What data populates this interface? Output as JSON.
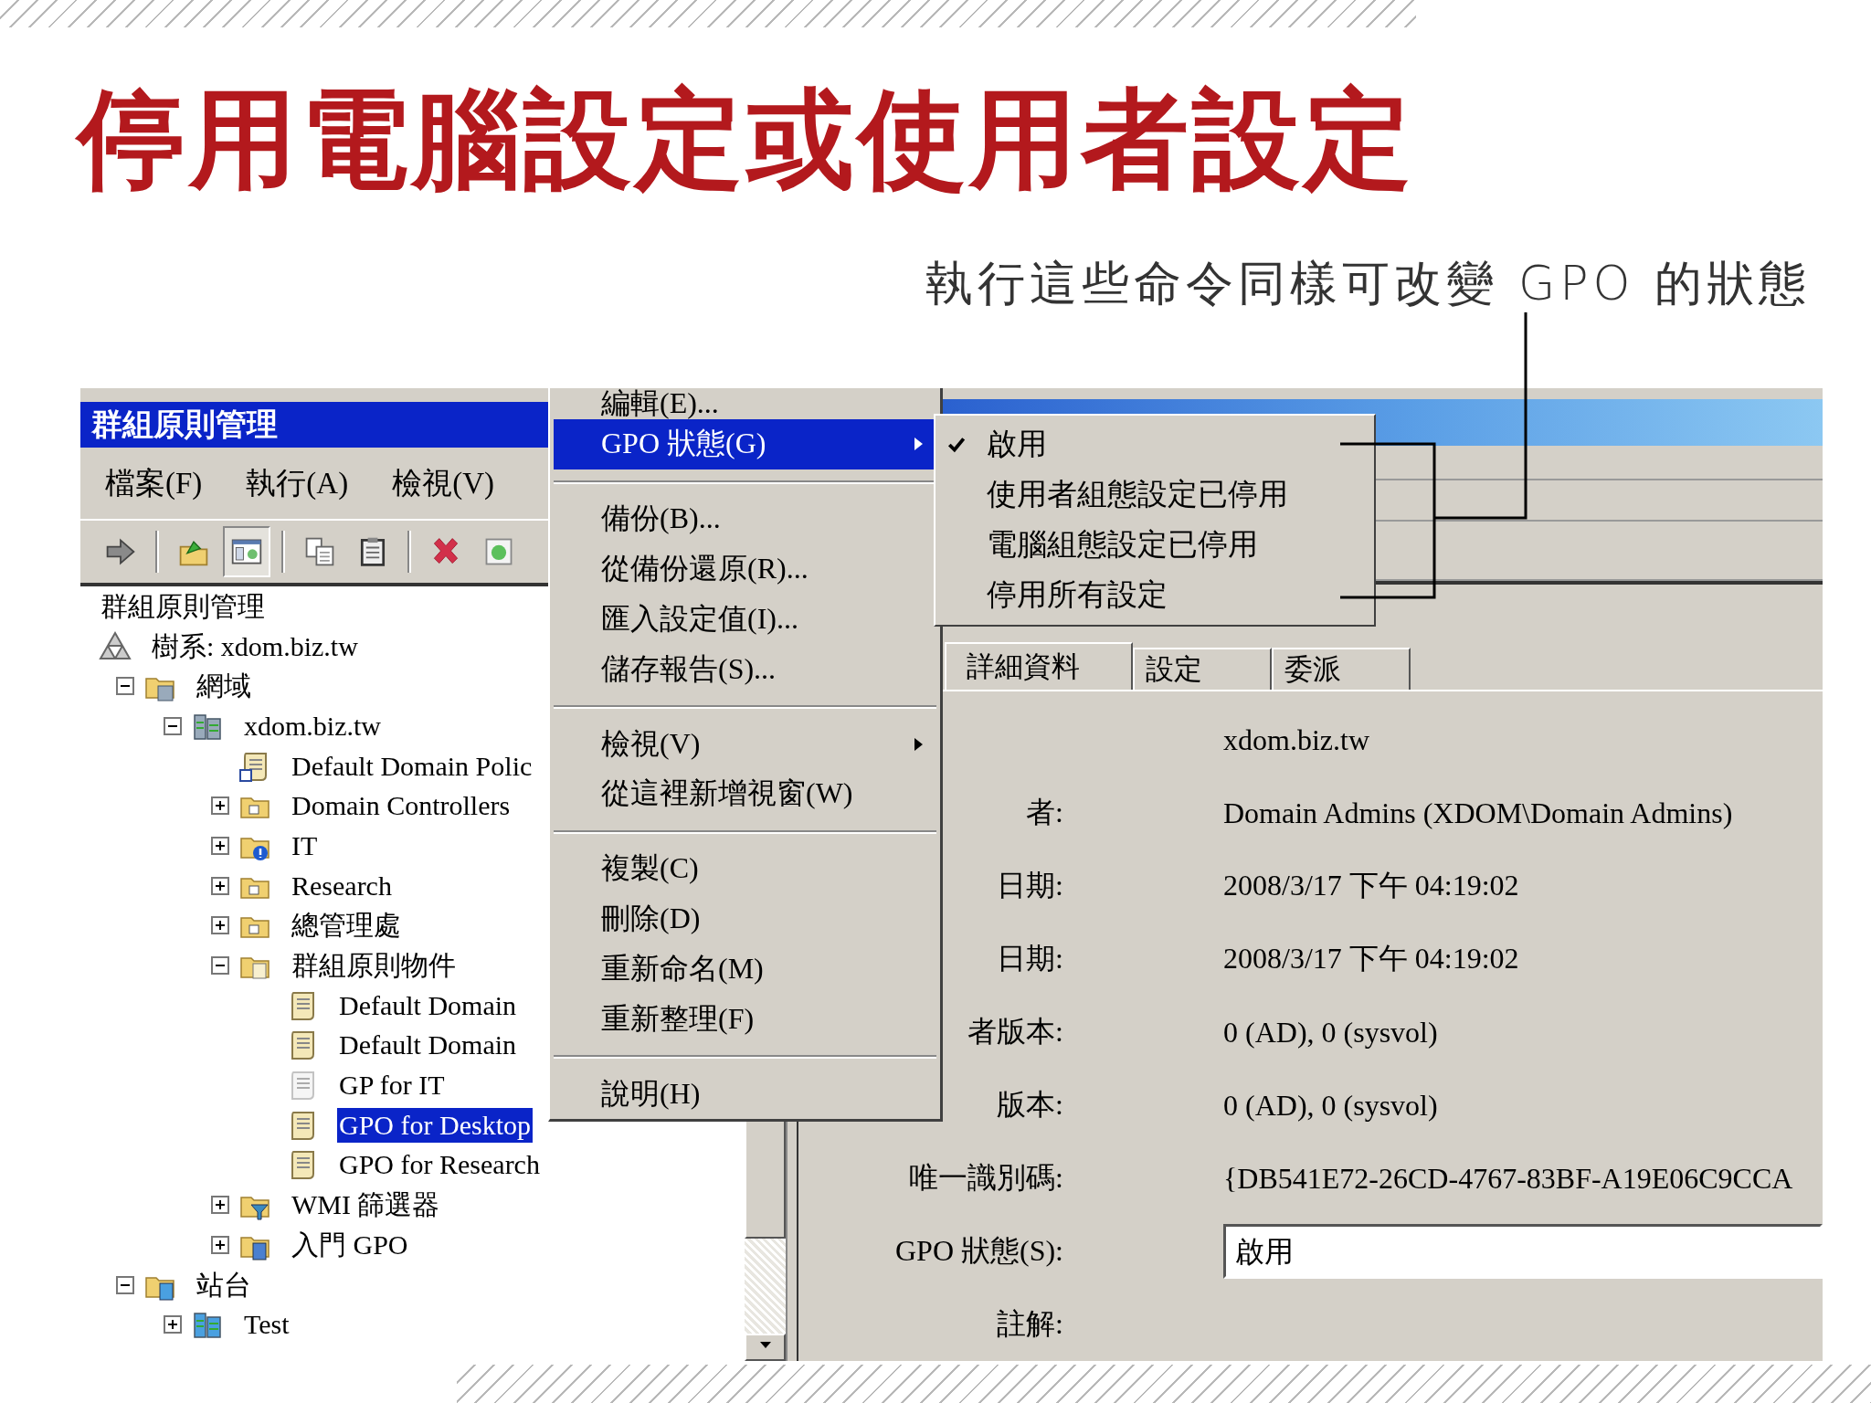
{
  "slide": {
    "title": "停用電腦設定或使用者設定",
    "callout": "執行這些命令同樣可改變 GPO 的狀態"
  },
  "console": {
    "title": "群組原則管理",
    "menu": [
      "檔案(F)",
      "執行(A)",
      "檢視(V)"
    ],
    "toolbar": [
      [
        {
          "kind": "forward",
          "pressed": false
        }
      ],
      [
        {
          "kind": "up",
          "pressed": false
        },
        {
          "kind": "tree",
          "pressed": true
        }
      ],
      [
        {
          "kind": "copy",
          "pressed": false
        },
        {
          "kind": "paste",
          "pressed": false
        }
      ],
      [
        {
          "kind": "delete",
          "pressed": false
        },
        {
          "kind": "refresh",
          "pressed": false
        }
      ]
    ],
    "tree": [
      {
        "label": "群組原則管理",
        "selected": false,
        "children": [
          {
            "label": "樹系: xdom.biz.tw",
            "kind": "forest",
            "selected": false,
            "children": [
              {
                "label": "網域",
                "kind": "domains",
                "expanded": true,
                "selected": false,
                "children": [
                  {
                    "label": "xdom.biz.tw",
                    "kind": "domain",
                    "expanded": true,
                    "selected": false,
                    "children": [
                      {
                        "label": "Default Domain Polic",
                        "kind": "link",
                        "selected": false
                      },
                      {
                        "label": "Domain Controllers",
                        "kind": "ou",
                        "expanded": false,
                        "selected": false
                      },
                      {
                        "label": "IT",
                        "kind": "ouinfo",
                        "expanded": false,
                        "selected": false
                      },
                      {
                        "label": "Research",
                        "kind": "ou",
                        "expanded": false,
                        "selected": false
                      },
                      {
                        "label": "總管理處",
                        "kind": "ou",
                        "expanded": false,
                        "selected": false
                      },
                      {
                        "label": "群組原則物件",
                        "kind": "gpofolder",
                        "expanded": true,
                        "selected": false,
                        "children": [
                          {
                            "label": "Default Domain",
                            "kind": "gpo",
                            "disabled": false,
                            "selected": false
                          },
                          {
                            "label": "Default Domain",
                            "kind": "gpo",
                            "disabled": false,
                            "selected": false
                          },
                          {
                            "label": "GP for IT",
                            "kind": "gpo",
                            "disabled": true,
                            "selected": false
                          },
                          {
                            "label": "GPO for Desktop",
                            "kind": "gpo",
                            "disabled": false,
                            "selected": true
                          },
                          {
                            "label": "GPO for Research",
                            "kind": "gpo",
                            "disabled": false,
                            "selected": false
                          }
                        ]
                      },
                      {
                        "label": "WMI 篩選器",
                        "kind": "wmi",
                        "expanded": false,
                        "selected": false
                      },
                      {
                        "label": "入門 GPO",
                        "kind": "starter",
                        "expanded": false,
                        "selected": false
                      }
                    ]
                  }
                ]
              },
              {
                "label": "站台",
                "kind": "sites",
                "expanded": true,
                "selected": false,
                "children": [
                  {
                    "label": "Test",
                    "kind": "site",
                    "expanded": false,
                    "selected": false
                  }
                ]
              }
            ]
          }
        ]
      }
    ]
  },
  "details": {
    "tabs": [
      {
        "label": "詳細資料",
        "selected": true
      },
      {
        "label": "設定",
        "selected": false
      },
      {
        "label": "委派",
        "selected": false
      }
    ],
    "rows": [
      {
        "kind": "text",
        "value": "xdom.biz.tw"
      },
      {
        "kind": "text",
        "label": "者:",
        "value": "Domain Admins (XDOM\\Domain Admins)"
      },
      {
        "kind": "text",
        "label": "日期:",
        "value": "2008/3/17 下午 04:19:02"
      },
      {
        "kind": "text",
        "label": "日期:",
        "value": "2008/3/17 下午 04:19:02"
      },
      {
        "kind": "text",
        "label": "者版本:",
        "value": "0 (AD), 0 (sysvol)"
      },
      {
        "kind": "text",
        "label": "版本:",
        "value": "0 (AD), 0 (sysvol)"
      },
      {
        "kind": "text",
        "label": "唯一識別碼:",
        "value": "{DB541E72-26CD-4767-83BF-A19E06C9CCA"
      },
      {
        "kind": "dropdown",
        "label": "GPO 狀態(S):",
        "value": "啟用"
      },
      {
        "kind": "text",
        "label": "註解:"
      }
    ]
  },
  "context_menu": [
    {
      "kind": "item",
      "label": "編輯(E)...",
      "selected": false,
      "submenu": false
    },
    {
      "kind": "item",
      "label": "GPO 狀態(G)",
      "selected": true,
      "submenu": true
    },
    {
      "kind": "separator"
    },
    {
      "kind": "item",
      "label": "備份(B)...",
      "selected": false,
      "submenu": false
    },
    {
      "kind": "item",
      "label": "從備份還原(R)...",
      "selected": false,
      "submenu": false
    },
    {
      "kind": "item",
      "label": "匯入設定值(I)...",
      "selected": false,
      "submenu": false
    },
    {
      "kind": "item",
      "label": "儲存報告(S)...",
      "selected": false,
      "submenu": false
    },
    {
      "kind": "separator"
    },
    {
      "kind": "item",
      "label": "檢視(V)",
      "selected": false,
      "submenu": true
    },
    {
      "kind": "item",
      "label": "從這裡新增視窗(W)",
      "selected": false,
      "submenu": false
    },
    {
      "kind": "separator"
    },
    {
      "kind": "item",
      "label": "複製(C)",
      "selected": false,
      "submenu": false
    },
    {
      "kind": "item",
      "label": "刪除(D)",
      "selected": false,
      "submenu": false
    },
    {
      "kind": "item",
      "label": "重新命名(M)",
      "selected": false,
      "submenu": false
    },
    {
      "kind": "item",
      "label": "重新整理(F)",
      "selected": false,
      "submenu": false
    },
    {
      "kind": "separator"
    },
    {
      "kind": "item",
      "label": "說明(H)",
      "selected": false,
      "submenu": false
    }
  ],
  "submenu": [
    {
      "label": "啟用",
      "checked": true
    },
    {
      "label": "使用者組態設定已停用",
      "checked": false
    },
    {
      "label": "電腦組態設定已停用",
      "checked": false
    },
    {
      "label": "停用所有設定",
      "checked": false
    }
  ]
}
